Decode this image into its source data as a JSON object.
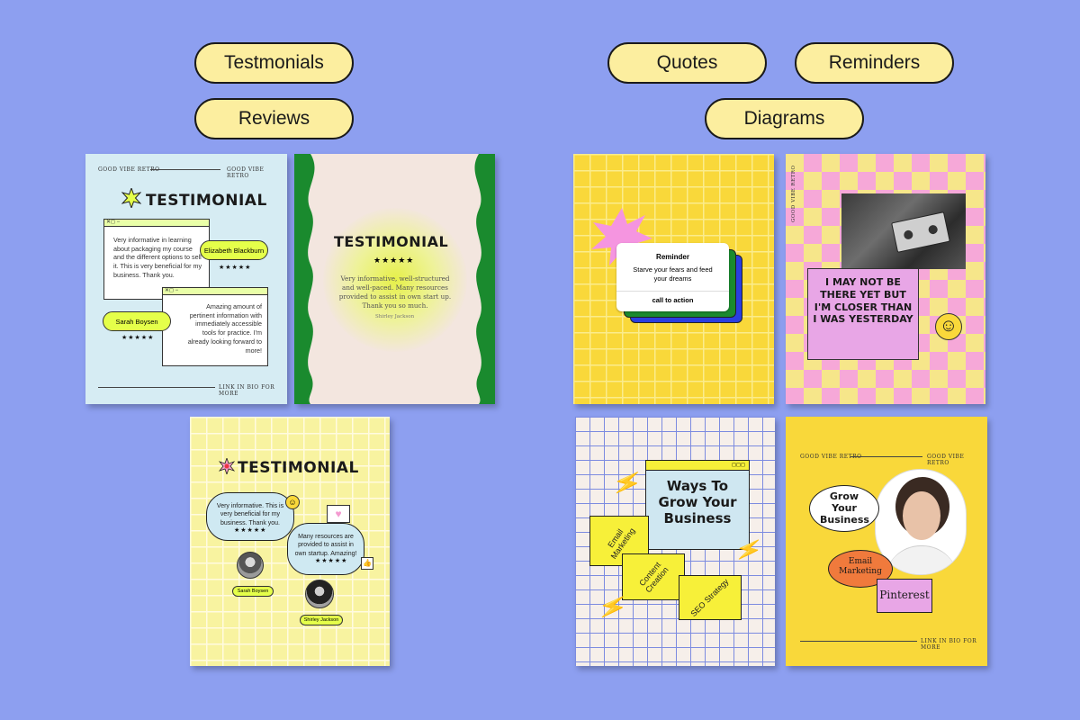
{
  "pills": {
    "testimonials": "Testmonials",
    "reviews": "Reviews",
    "quotes": "Quotes",
    "reminders": "Reminders",
    "diagrams": "Diagrams"
  },
  "card1": {
    "header_left": "GOOD VIBE RETRO",
    "header_right": "GOOD VIBE RETRO",
    "title": "TESTIMONIAL",
    "review1": "Very informative in learning about packaging my course and the different options to sell it. This is very beneficial for my business. Thank you.",
    "name1": "Elizabeth Blackburn",
    "review2": "Amazing amount of pertinent information with immediately accessible tools for practice. I'm already looking forward to more!",
    "name2": "Sarah Boysen",
    "stars": "★★★★★",
    "footer": "LINK IN BIO FOR MORE"
  },
  "card2": {
    "title": "TESTIMONIAL",
    "stars": "★★★★★",
    "text": "Very informative, well-structured and well-paced. Many resources provided to assist in own start up. Thank you so much.",
    "author": "Shirley Jackson"
  },
  "card3": {
    "title": "TESTIMONIAL",
    "bubble1": "Very informative. This is very beneficial for my business. Thank you.",
    "bubble2": "Many resources are provided to assist in own startup. Amazing!",
    "stars": "★★★★★",
    "name1": "Sarah Boysen",
    "name2": "Shirley Jackson"
  },
  "card4": {
    "heading": "Reminder",
    "text": "Starve your fears and feed your dreams",
    "cta": "call to action"
  },
  "card5": {
    "side_text": "GOOD VIBE RETRO",
    "quote": "I MAY NOT BE THERE YET BUT I'M CLOSER THAN I WAS YESTERDAY"
  },
  "card6": {
    "title": "Ways To Grow Your Business",
    "folder1": "Email Marketing",
    "folder2": "Content Creation",
    "folder3": "SEO Strategy"
  },
  "card7": {
    "header_left": "GOOD VIBE RETRO",
    "header_right": "GOOD VIBE RETRO",
    "bubble": "Grow Your Business",
    "email": "Email Marketing",
    "pinterest": "Pinterest",
    "footer": "LINK IN BIO FOR MORE"
  },
  "colors": {
    "background": "#8d9ff0",
    "pill": "#fcee9f",
    "lime": "#e5ff4a",
    "green": "#1a8a2e",
    "yellow": "#f9d83a",
    "pink": "#f6a8d8"
  }
}
